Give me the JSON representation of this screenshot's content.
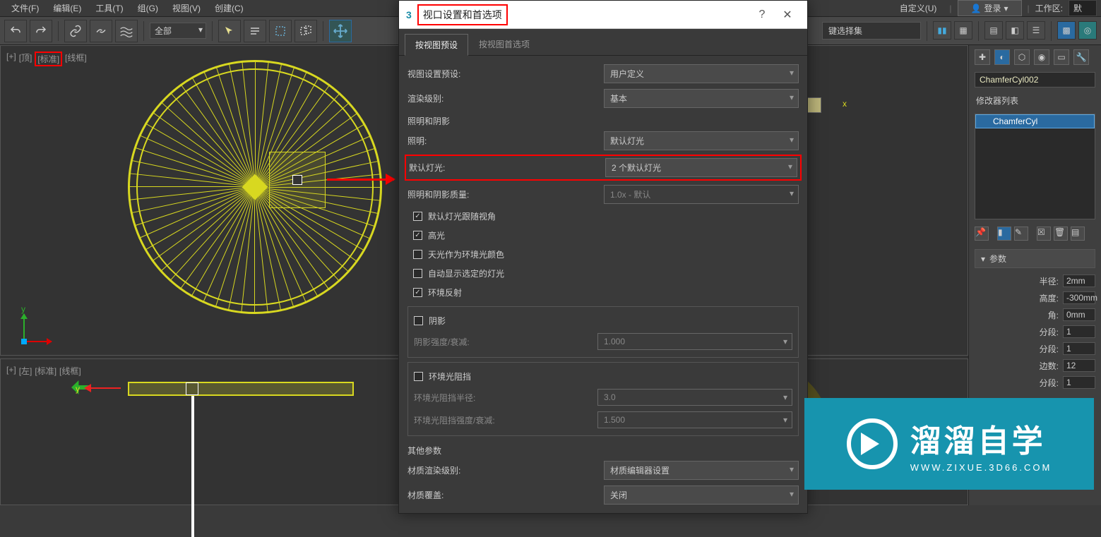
{
  "menu": {
    "file": "文件(F)",
    "edit": "编辑(E)",
    "tools": "工具(T)",
    "group": "组(G)",
    "views": "视图(V)",
    "create": "创建(C)",
    "customize": "自定义(U)",
    "login": "登录",
    "workspace_label": "工作区:",
    "workspace_value": "默"
  },
  "toolbar": {
    "all": "全部",
    "select_set": "键选择集"
  },
  "viewport_top": {
    "plus": "[+]",
    "view": "[顶]",
    "shading": "[标准]",
    "wire": "[线框]",
    "axis_y": "y"
  },
  "viewport_left": {
    "plus": "[+]",
    "view": "[左]",
    "shading": "[标准]",
    "wire": "[线框]",
    "axis_y": "y"
  },
  "cube": {
    "x": "x"
  },
  "dialog": {
    "title": "视口设置和首选项",
    "help": "?",
    "close": "✕",
    "tabs": {
      "preset": "按视图预设",
      "prefs": "按视图首选项"
    },
    "labels": {
      "view_preset": "视图设置预设:",
      "render_level": "渲染级别:",
      "lighting_section": "照明和阴影",
      "lighting": "照明:",
      "default_lights": "默认灯光:",
      "light_quality": "照明和阴影质量:",
      "chk_follow": "默认灯光跟随视角",
      "chk_highlights": "高光",
      "chk_skylight": "天光作为环境光颜色",
      "chk_autoshow": "自动显示选定的灯光",
      "chk_envrefl": "环境反射",
      "chk_shadows": "阴影",
      "shadow_intensity": "阴影强度/衰减:",
      "chk_ao": "环境光阻挡",
      "ao_radius": "环境光阻挡半径:",
      "ao_intensity": "环境光阻挡强度/衰减:",
      "other_section": "其他参数",
      "mat_render": "材质渲染级别:",
      "mat_override": "材质覆盖:"
    },
    "values": {
      "view_preset": "用户定义",
      "render_level": "基本",
      "lighting": "默认灯光",
      "default_lights": "2 个默认灯光",
      "light_quality": "1.0x - 默认",
      "shadow_intensity": "1.000",
      "ao_radius": "3.0",
      "ao_intensity": "1.500",
      "mat_render": "材质编辑器设置",
      "mat_override": "关闭"
    }
  },
  "right_panel": {
    "object_name": "ChamferCyl002",
    "modifier_list": "修改器列表",
    "modifier_item": "ChamferCyl",
    "rollout_params": "参数",
    "params": {
      "radius_label": "半径:",
      "radius_val": "2mm",
      "height_label": "高度:",
      "height_val": "-300mm",
      "fillet_label": "角:",
      "fillet_val": "0mm",
      "seg1_label": "分段:",
      "seg1_val": "1",
      "seg2_label": "分段:",
      "seg2_val": "1",
      "sides_label": "边数:",
      "sides_val": "12",
      "seg3_label": "分段:",
      "seg3_val": "1"
    }
  },
  "watermark": {
    "cn": "溜溜自学",
    "en": "WWW.ZIXUE.3D66.COM"
  }
}
